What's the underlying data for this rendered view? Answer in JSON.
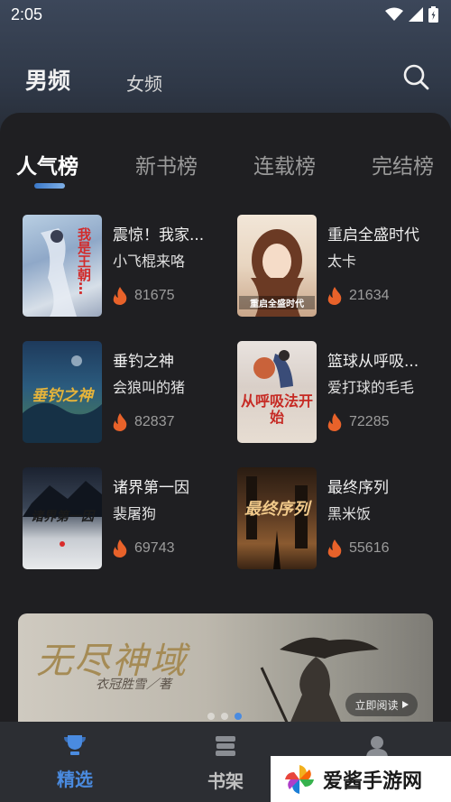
{
  "status": {
    "time": "2:05"
  },
  "header": {
    "tabs": [
      {
        "label": "男频",
        "active": true
      },
      {
        "label": "女频",
        "active": false
      }
    ]
  },
  "ranking": {
    "tabs": [
      {
        "label": "人气榜",
        "active": true
      },
      {
        "label": "新书榜"
      },
      {
        "label": "连载榜"
      },
      {
        "label": "完结榜"
      }
    ]
  },
  "books": [
    {
      "title": "震惊！我家...",
      "author": "小飞棍来咯",
      "heat": "81675",
      "cover_text": "我是王朝…"
    },
    {
      "title": "重启全盛时代",
      "author": "太卡",
      "heat": "21634",
      "cover_text": "重启全盛时代"
    },
    {
      "title": "垂钓之神",
      "author": "会狼叫的猪",
      "heat": "82837",
      "cover_text": "垂钓之神"
    },
    {
      "title": "篮球从呼吸...",
      "author": "爱打球的毛毛",
      "heat": "72285",
      "cover_text": "从呼吸法开始"
    },
    {
      "title": "诸界第一因",
      "author": "裴屠狗",
      "heat": "69743",
      "cover_text": "诸界第一因"
    },
    {
      "title": "最终序列",
      "author": "黑米饭",
      "heat": "55616",
      "cover_text": "最终序列"
    }
  ],
  "banner": {
    "title": "无尽神域",
    "subtitle": "衣冠胜雪／著",
    "read_label": "立即阅读"
  },
  "bottom_nav": [
    {
      "label": "精选",
      "icon": "trophy-icon",
      "active": true
    },
    {
      "label": "书架",
      "icon": "books-icon",
      "active": false
    },
    {
      "label": "",
      "icon": "profile-icon",
      "active": false
    }
  ],
  "watermark": {
    "text": "爱酱手游网"
  },
  "colors": {
    "accent": "#4a8be0",
    "panel": "#1f1f22",
    "fire": "#e8622a"
  }
}
